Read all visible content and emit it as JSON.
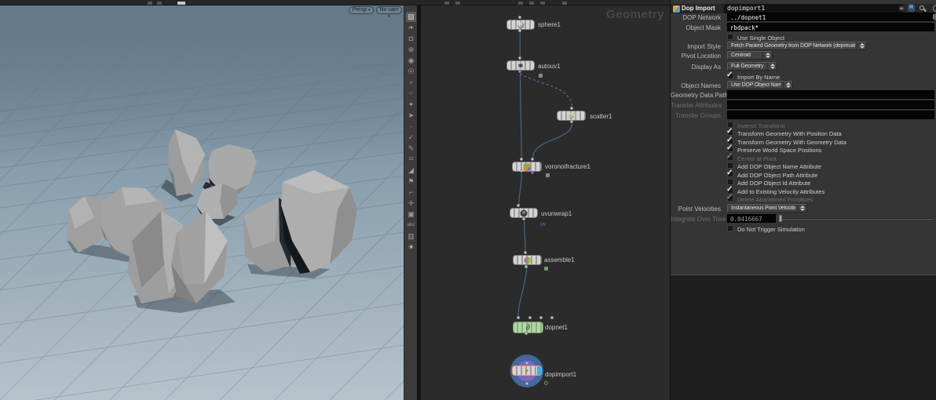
{
  "colors": {
    "viewport_bg_top": "#64798a",
    "viewport_bg_bottom": "#b7c3cb",
    "wire": "#4a6585",
    "wire_dashed": "#5b7fa6",
    "node_selected_outline": "#e09a86",
    "display_flag": "#35b2e2",
    "selection_halo_outer": "#44679e",
    "selection_halo_inner": "#7e68bd",
    "magenta_output": "#d957c8"
  },
  "viewport": {
    "persp_button": "Persp",
    "cam_button": "No cam",
    "caret": "▾",
    "toolbar_icons": [
      {
        "name": "view-tool",
        "glyph": "▧"
      },
      {
        "name": "foliage",
        "glyph": "❧"
      },
      {
        "name": "lock",
        "glyph": "◘"
      },
      {
        "name": "gear",
        "glyph": "⊕"
      },
      {
        "name": "camera",
        "glyph": "◉"
      },
      {
        "name": "light-bulb",
        "glyph": "☉"
      },
      {
        "name": "key",
        "glyph": "⚬"
      },
      {
        "name": "points",
        "glyph": "⁘"
      },
      {
        "name": "star",
        "glyph": "✦"
      },
      {
        "name": "cursor",
        "glyph": "➤"
      },
      {
        "name": "dot",
        "glyph": "·"
      },
      {
        "name": "check",
        "glyph": "✓"
      },
      {
        "name": "pen",
        "glyph": "✎"
      },
      {
        "name": "point-numbers",
        "glyph": "¹²"
      },
      {
        "name": "normals",
        "glyph": "◢"
      },
      {
        "name": "flag",
        "glyph": "⚑"
      },
      {
        "name": "ruler",
        "glyph": "⌐"
      },
      {
        "name": "axis",
        "glyph": "✛"
      },
      {
        "name": "bounding-box",
        "glyph": "▣"
      },
      {
        "name": "text-abc",
        "glyph": "abc"
      },
      {
        "name": "image-plane",
        "glyph": "▥"
      },
      {
        "name": "headlight",
        "glyph": "☀"
      }
    ]
  },
  "network": {
    "watermark": "Geometry",
    "nodes": [
      {
        "id": "sphere1",
        "label": "sphere1"
      },
      {
        "id": "autouv1",
        "label": "autouv1"
      },
      {
        "id": "scatter1",
        "label": "scatter1"
      },
      {
        "id": "voronoifracture1",
        "label": "voronoifracture1"
      },
      {
        "id": "uvunwrap1",
        "label": "uvunwrap1",
        "sublabel": "uv"
      },
      {
        "id": "assemble1",
        "label": "assemble1"
      },
      {
        "id": "dopnet1",
        "label": "dopnet1"
      },
      {
        "id": "dopimport1",
        "label": "dopimport1"
      }
    ]
  },
  "panel": {
    "header": {
      "type_label": "Dop Import",
      "node_name": "dopimport1"
    },
    "rows": {
      "dop_network": {
        "label": "DOP Network",
        "value": "../dopnet1"
      },
      "object_mask": {
        "label": "Object Mask",
        "value": "rbdpack*"
      },
      "use_single_object": {
        "label": "Use Single Object",
        "mark": ""
      },
      "import_style": {
        "label": "Import Style",
        "value": "Fetch Packed Geometry from DOP Network (deprecated)"
      },
      "pivot_location": {
        "label": "Pivot Location",
        "value": "Centroid"
      },
      "display_as": {
        "label": "Display As",
        "value": "Full Geometry"
      },
      "import_by_name": {
        "label": "Import By Name",
        "mark": "✓"
      },
      "object_names": {
        "label": "Object Names",
        "value": "Use DOP Object Name"
      },
      "geometry_data_path": {
        "label": "Geometry Data Path",
        "value": ""
      },
      "transfer_attributes": {
        "label": "Transfer Attributes",
        "value": ""
      },
      "transfer_groups": {
        "label": "Transfer Groups",
        "value": ""
      },
      "inverse_transform": {
        "label": "Inverse Transform",
        "mark": ""
      },
      "transform_position": {
        "label": "Transform Geometry With Position Data",
        "mark": "✓"
      },
      "transform_geometry": {
        "label": "Transform Geometry With Geometry Data",
        "mark": "✓"
      },
      "preserve_world": {
        "label": "Preserve World Space Positions",
        "mark": "✓"
      },
      "center_at_pivot": {
        "label": "Center at Pivot",
        "mark": "✓"
      },
      "add_name_attr": {
        "label": "Add DOP Object Name Attribute",
        "mark": ""
      },
      "add_path_attr": {
        "label": "Add DOP Object Path Attribute",
        "mark": "✓"
      },
      "add_id_attr": {
        "label": "Add DOP Object Id Attribute",
        "mark": ""
      },
      "add_velocity": {
        "label": "Add to Existing Velocity Attributes",
        "mark": "✓"
      },
      "delete_abandoned": {
        "label": "Delete Abandoned Primitives",
        "mark": "✓"
      },
      "point_velocities": {
        "label": "Point Velocities",
        "value": "Instantaneous Point Velocities"
      },
      "integrate_over_time": {
        "label": "Integrate Over Time",
        "value": "0.0416667"
      },
      "do_not_trigger": {
        "label": "Do Not Trigger Simulation",
        "mark": ""
      }
    }
  }
}
